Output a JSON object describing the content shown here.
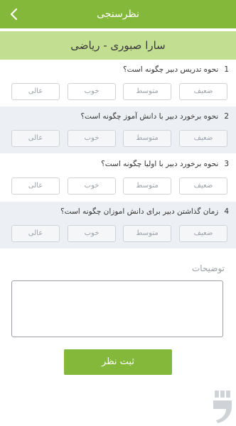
{
  "header": {
    "title": "نظرسنجی"
  },
  "student": {
    "name": "سارا صبوری - ریاضی"
  },
  "questions": [
    {
      "num": "1",
      "text": "نحوه تدریس دبیر چگونه است؟"
    },
    {
      "num": "2",
      "text": "نحوه برخورد دبیر با دانش آموز چگونه است؟"
    },
    {
      "num": "3",
      "text": "نحوه برخورد دبیر با اولیا چگونه است؟"
    },
    {
      "num": "4",
      "text": "زمان گذاشتن دبیر برای دانش اموزان چگونه است؟"
    }
  ],
  "options": {
    "weak": "ضعیف",
    "average": "متوسط",
    "good": "خوب",
    "excellent": "عالی"
  },
  "comments": {
    "label": "توضیحات",
    "value": ""
  },
  "submit": {
    "label": "ثبت نظر"
  },
  "colors": {
    "primary": "#84b83a",
    "student_bar": "#c2de90",
    "shaded": "#eceff3"
  },
  "icons": {
    "back": "chevron-left-icon",
    "brand": "app-logo-icon"
  }
}
